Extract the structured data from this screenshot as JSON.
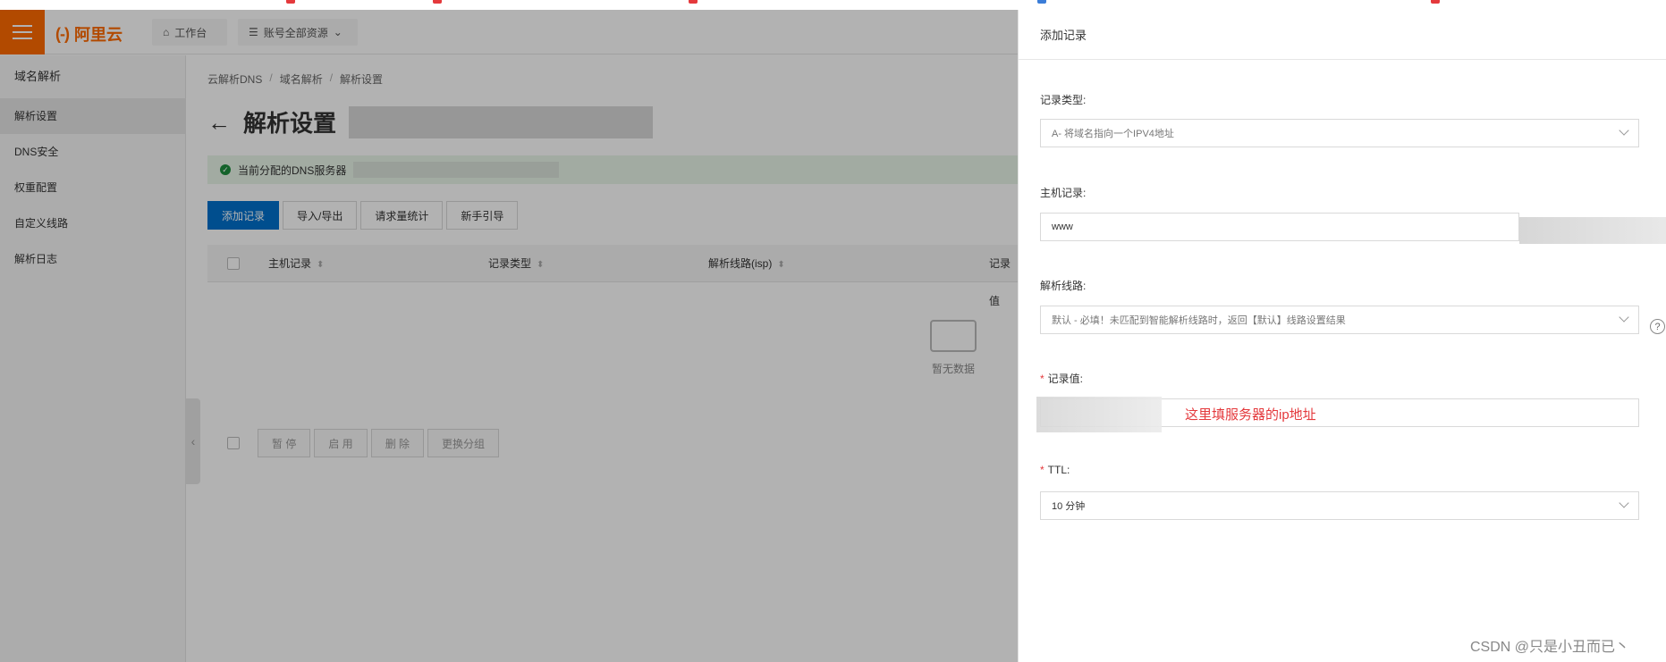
{
  "topbar": {
    "logo_text": "阿里云",
    "logo_mark": "(-)",
    "workbench_label": "工作台",
    "resources_label": "账号全部资源"
  },
  "sidebar": {
    "title": "域名解析",
    "items": [
      {
        "label": "解析设置",
        "active": true
      },
      {
        "label": "DNS安全",
        "active": false
      },
      {
        "label": "权重配置",
        "active": false
      },
      {
        "label": "自定义线路",
        "active": false
      },
      {
        "label": "解析日志",
        "active": false
      }
    ]
  },
  "main": {
    "breadcrumb": [
      "云解析DNS",
      "域名解析",
      "解析设置"
    ],
    "page_title": "解析设置",
    "dns_notice": "当前分配的DNS服务器",
    "toolbar": {
      "add_record": "添加记录",
      "import_export": "导入/导出",
      "request_stats": "请求量统计",
      "guide": "新手引导"
    },
    "table_headers": [
      "主机记录",
      "记录类型",
      "解析线路(isp)",
      "记录值"
    ],
    "empty_text": "暂无数据",
    "batch": [
      "暂 停",
      "启 用",
      "删 除",
      "更换分组"
    ]
  },
  "drawer": {
    "title": "添加记录",
    "record_type_label": "记录类型:",
    "record_type_value": "A- 将域名指向一个IPV4地址",
    "host_label": "主机记录:",
    "host_value": "www",
    "line_label": "解析线路:",
    "line_value": "默认 - 必填！未匹配到智能解析线路时，返回【默认】线路设置结果",
    "value_label": "记录值:",
    "annotation": "这里填服务器的ip地址",
    "ttl_label": "TTL:",
    "ttl_value": "10 分钟",
    "required_mark": "*",
    "help_glyph": "?"
  },
  "watermark": "CSDN @只是小丑而已丶",
  "colors": {
    "brand": "#ff6a00",
    "primary": "#0070cc",
    "required": "#e4393c",
    "success": "#1e8e3e"
  }
}
